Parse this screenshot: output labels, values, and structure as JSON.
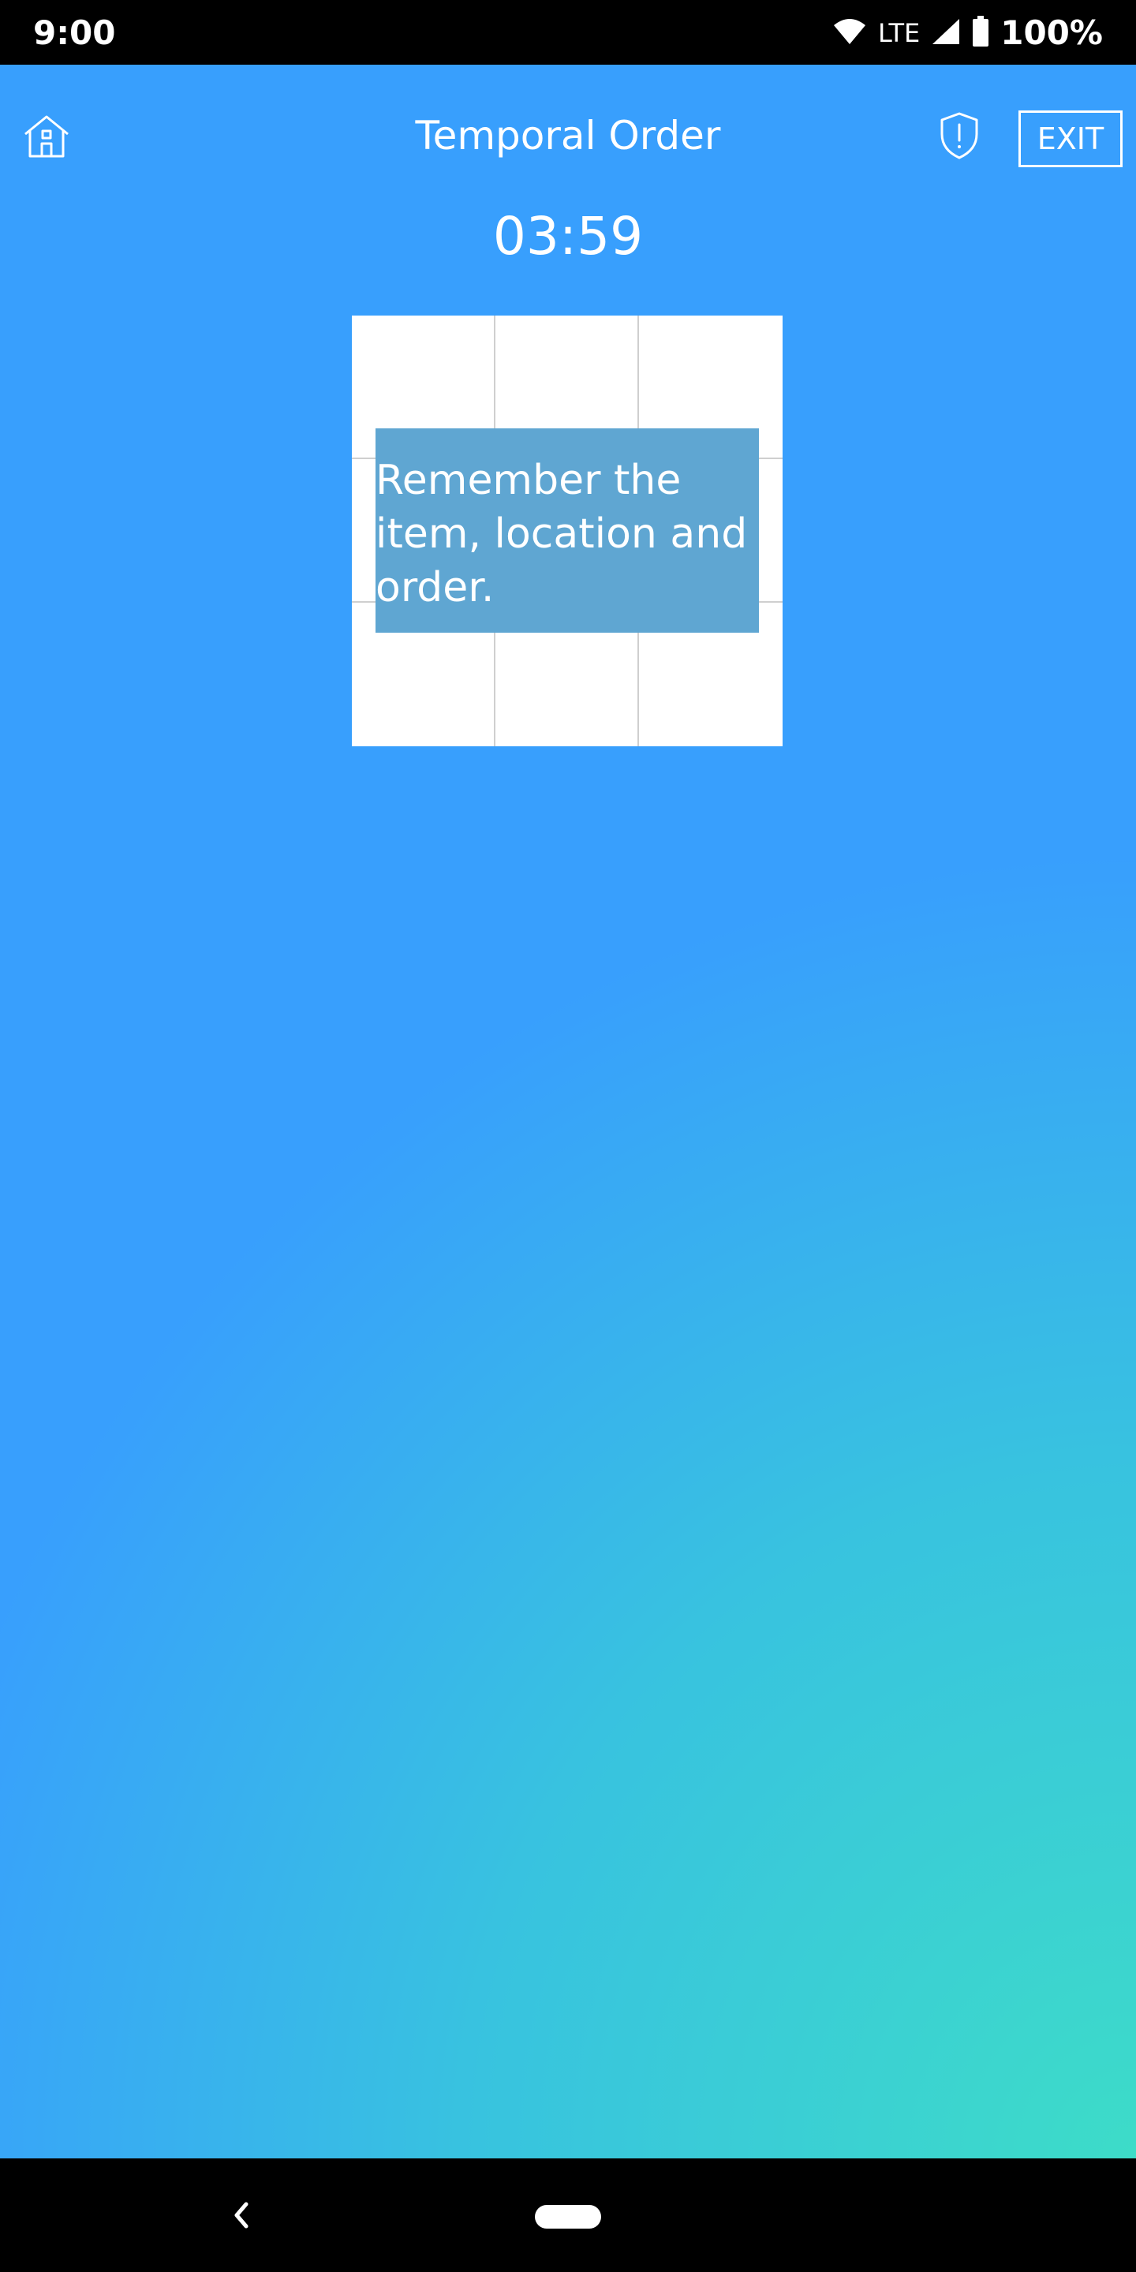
{
  "status_bar": {
    "time": "9:00",
    "network": "LTE",
    "battery": "100%",
    "icons": [
      "wifi-icon",
      "cell-signal-icon",
      "battery-icon"
    ]
  },
  "header": {
    "title": "Temporal Order",
    "exit_label": "EXIT",
    "icons": [
      "home-icon",
      "shield-alert-icon"
    ]
  },
  "timer": "03:59",
  "grid": {
    "rows": 3,
    "columns": 3
  },
  "instruction": {
    "lines": [
      "Remember the",
      "item, location and",
      "order."
    ]
  },
  "nav_bar": {
    "icons": [
      "back-icon",
      "home-pill"
    ]
  },
  "colors": {
    "background_top": "#389ffd",
    "background_bottom": "#3ddcc8",
    "instruction_bg": "#5fa6d2",
    "grid_bg": "#ffffff",
    "grid_lines": "#cfcfcf"
  }
}
